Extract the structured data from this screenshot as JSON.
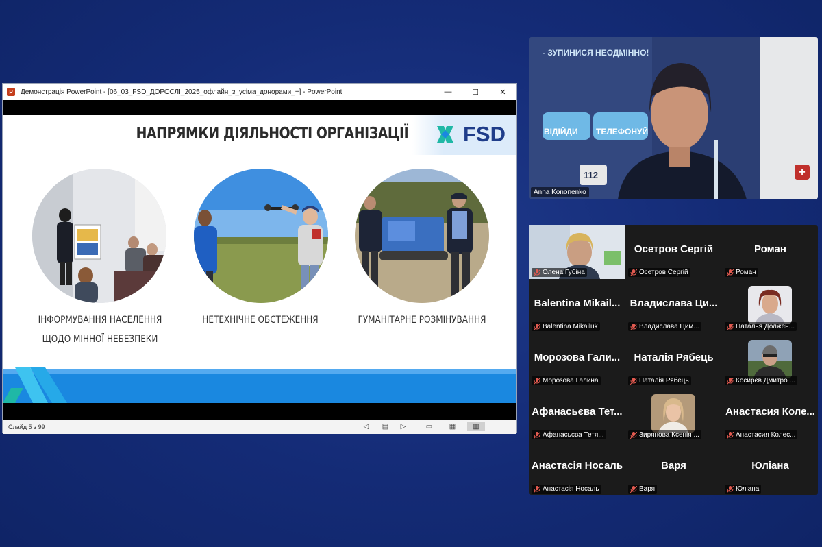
{
  "window": {
    "title": "Демонстрація PowerPoint - [06_03_FSD_ДОРОСЛІ_2025_офлайн_з_усіма_донорами_+] - PowerPoint",
    "app_icon": "P",
    "minimize": "—",
    "maximize": "☐",
    "close": "✕"
  },
  "slide": {
    "title": "НАПРЯМКИ ДІЯЛЬНОСТІ ОРГАНІЗАЦІЇ",
    "logo_text": "FSD",
    "captions": [
      {
        "line1": "ІНФОРМУВАННЯ НАСЕЛЕННЯ",
        "line2": "ЩОДО МІННОЇ НЕБЕЗПЕКИ"
      },
      {
        "line1": "НЕТЕХНІЧНЕ ОБСТЕЖЕННЯ",
        "line2": ""
      },
      {
        "line1": "ГУМАНІТАРНЕ РОЗМІНУВАННЯ",
        "line2": ""
      }
    ],
    "colors": {
      "brand_blue": "#1f3d8a",
      "footer_blue": "#1a88e0",
      "teal": "#1fb8a6"
    }
  },
  "statusbar": {
    "slide_counter": "Слайд 5 з 99"
  },
  "speaker": {
    "name": "Anna Kononenko",
    "background_text": {
      "banner": "- ЗУПИНИСЯ НЕОДМІННО!",
      "btn1": "ВІДІЙДИ",
      "btn2": "ТЕЛЕФОНУЙ",
      "num": "112"
    }
  },
  "gallery": [
    {
      "big": "",
      "tag": "Олена Губіна",
      "photo": true
    },
    {
      "big": "Осетров Сергій",
      "tag": "Осетров Сергій"
    },
    {
      "big": "Роман",
      "tag": "Роман"
    },
    {
      "big": "Balentina Mikail...",
      "tag": "Balentina Mikailuk"
    },
    {
      "big": "Владислава Ци...",
      "tag": "Владислава Цим..."
    },
    {
      "big": "",
      "tag": "Наталья Должен...",
      "photo": true
    },
    {
      "big": "Морозова Гали...",
      "tag": "Морозова Галина"
    },
    {
      "big": "Наталія Рябець",
      "tag": "Наталія Рябець"
    },
    {
      "big": "",
      "tag": "Косирєв Дмитро ...",
      "photo": true
    },
    {
      "big": "Афанасьєва Тет...",
      "tag": "Афанасьєва Тетя..."
    },
    {
      "big": "",
      "tag": "Зирянова Ксенія ...",
      "photo": true
    },
    {
      "big": "Анастасия Коле...",
      "tag": "Анастасия Колес..."
    },
    {
      "big": "Анастасія Носаль",
      "tag": "Анастасія Носаль"
    },
    {
      "big": "Варя",
      "tag": "Варя"
    },
    {
      "big": "Юліана",
      "tag": "Юліана"
    }
  ]
}
